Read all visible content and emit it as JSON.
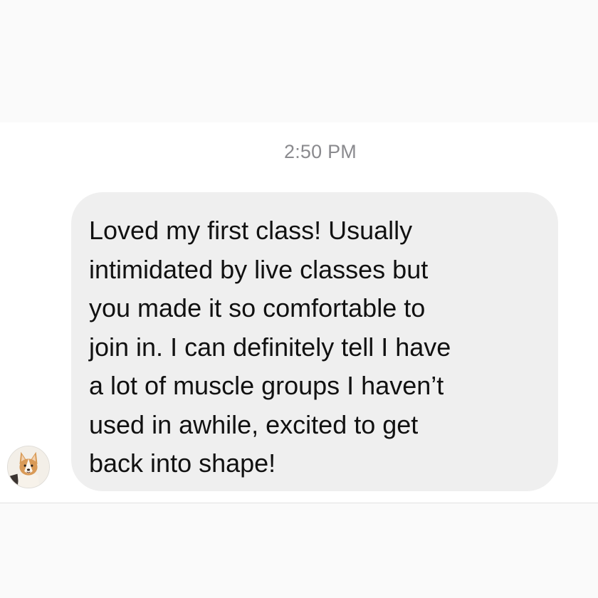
{
  "conversation": {
    "timestamp": "2:50 PM",
    "message": {
      "text": "Loved my first class! Usually\nintimidated by live classes but\nyou made it so comfortable to\njoin in.  I can definitely tell I have\na lot of muscle groups I haven’t\nused in awhile, excited to get\nback into shape!",
      "sender_avatar_icon": "corgi-avatar-icon"
    }
  },
  "colors": {
    "bubble": "#efefef",
    "background": "#ffffff",
    "band": "#fafafa",
    "timestamp": "#8a8a8e",
    "message_text": "#111111"
  }
}
